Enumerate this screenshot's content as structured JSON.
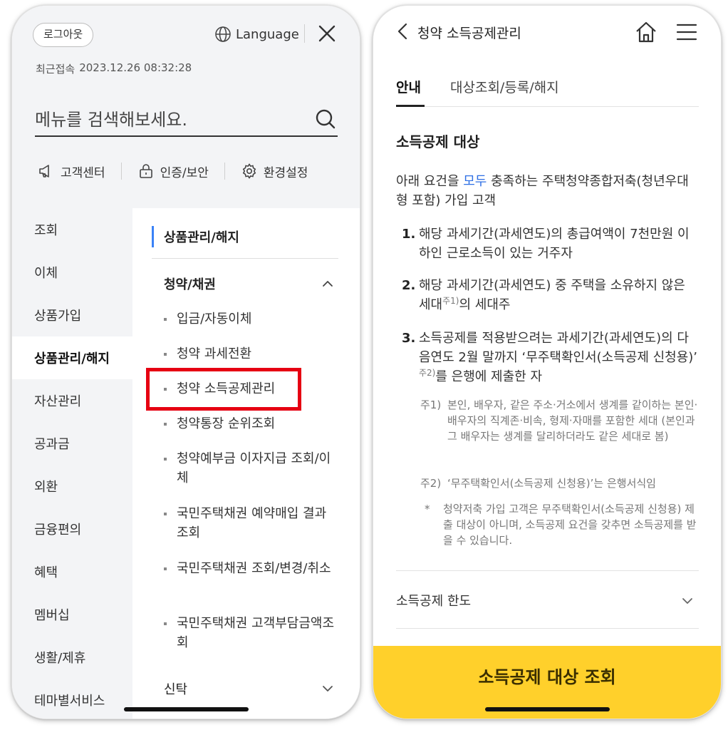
{
  "left": {
    "header": {
      "logout_label": "로그아웃",
      "language_label": "Language",
      "recent_prefix": "최근접속",
      "recent_time": "2023.12.26 08:32:28"
    },
    "search": {
      "placeholder": "메뉴를 검색해보세요."
    },
    "quick_links": [
      "고객센터",
      "인증/보안",
      "환경설정"
    ],
    "categories": [
      "조회",
      "이체",
      "상품가입",
      "상품관리/해지",
      "자산관리",
      "공과금",
      "외환",
      "금융편의",
      "혜택",
      "멤버십",
      "생활/제휴",
      "테마별서비스"
    ],
    "active_category": "상품관리/해지",
    "sub_title": "상품관리/해지",
    "section_open": "청약/채권",
    "sub_items": [
      "입금/자동이체",
      "청약 과세전환",
      "청약 소득공제관리",
      "청약통장 순위조회",
      "청약예부금 이자지급 조회/이체",
      "국민주택채권 예약매입 결과조회",
      "국민주택채권 조회/변경/취소",
      "국민주택채권 고객부담금액조회"
    ],
    "highlighted_item": "청약 소득공제관리",
    "section_closed": "신탁"
  },
  "right": {
    "header": {
      "title": "청약 소득공제관리"
    },
    "tabs": [
      "안내",
      "대상조회/등록/해지"
    ],
    "active_tab": "안내",
    "section_title": "소득공제 대상",
    "intro_before": "아래 요건을 ",
    "intro_accent": "모두",
    "intro_after": " 충족하는 주택청약종합저축(청년우대형 포함) 가입 고객",
    "conditions": [
      {
        "num": "1.",
        "text": "해당 과세기간(과세연도)의 총급여액이 7천만원 이하인 근로소득이 있는 거주자"
      },
      {
        "num": "2.",
        "text": "해당 과세기간(과세연도) 중 주택을 소유하지 않은 세대",
        "sup": "주1)",
        "tail": "의 세대주"
      },
      {
        "num": "3.",
        "text": "소득공제를 적용받으려는 과세기간(과세연도)의 다음연도 2월 말까지 ‘무주택확인서(소득공제 신청용)’ ",
        "sup": "주2)",
        "tail": "를 은행에 제출한 자"
      }
    ],
    "notes": [
      {
        "label": "주1)",
        "text": "본인, 배우자, 같은 주소·거소에서 생계를 같이하는 본인·배우자의 직계존·비속, 형제·자매를 포함한 세대 (본인과 그 배우자는 생계를 달리하더라도 같은 세대로 봄)"
      },
      {
        "label": "주2)",
        "text": "‘무주택확인서(소득공제 신청용)’는 은행서식임"
      },
      {
        "label": "*",
        "text": "청약저축 가입 고객은 무주택확인서(소득공제 신청용) 제출 대상이 아니며, 소득공제 요건을 갖추면 소득공제를 받을 수 있습니다."
      }
    ],
    "accordion_label": "소득공제 한도",
    "cta_label": "소득공제 대상 조회",
    "colors": {
      "cta_bg": "#ffd02b",
      "accent": "#2f6fe4",
      "highlight_border": "#e60012"
    }
  }
}
